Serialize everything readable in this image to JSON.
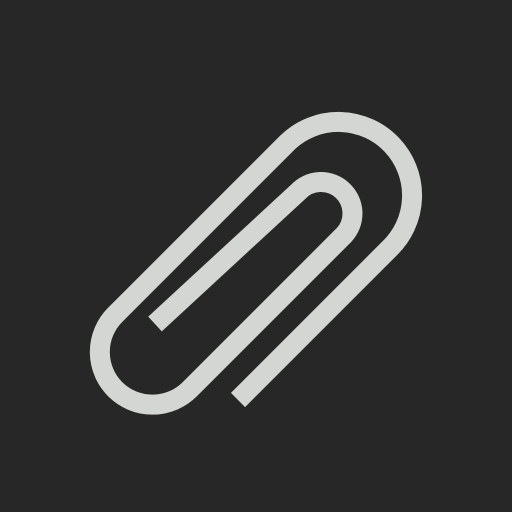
{
  "icon": {
    "name": "paperclip-icon",
    "background_color": "#272727",
    "stroke_color": "#D4D6D3"
  }
}
